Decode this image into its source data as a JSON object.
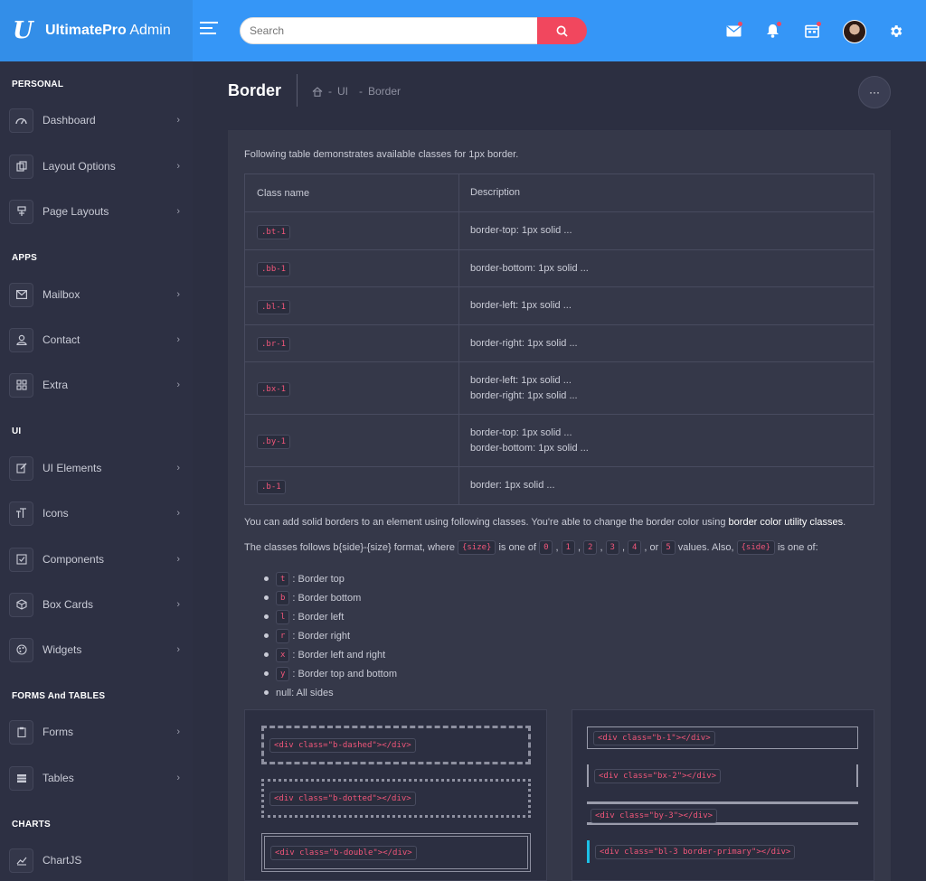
{
  "brand": {
    "logo": "U",
    "name_bold": "UltimatePro",
    "name_rest": " Admin"
  },
  "search": {
    "placeholder": "Search"
  },
  "colors": {
    "header": "#3596f7",
    "accent": "#f1475e",
    "code": "#f1567a",
    "primary": "#1cc0e6"
  },
  "sidebar": {
    "sections": [
      {
        "title": "PERSONAL",
        "items": [
          {
            "label": "Dashboard",
            "icon": "gauge-icon"
          },
          {
            "label": "Layout Options",
            "icon": "copy-icon"
          },
          {
            "label": "Page Layouts",
            "icon": "layers-icon"
          }
        ]
      },
      {
        "title": "APPS",
        "items": [
          {
            "label": "Mailbox",
            "icon": "mail-icon"
          },
          {
            "label": "Contact",
            "icon": "user-icon"
          },
          {
            "label": "Extra",
            "icon": "grid-icon"
          }
        ]
      },
      {
        "title": "UI",
        "items": [
          {
            "label": "UI Elements",
            "icon": "edit-icon"
          },
          {
            "label": "Icons",
            "icon": "text-size-icon"
          },
          {
            "label": "Components",
            "icon": "check-square-icon"
          },
          {
            "label": "Box Cards",
            "icon": "box-icon"
          },
          {
            "label": "Widgets",
            "icon": "palette-icon"
          }
        ]
      },
      {
        "title": "FORMS And TABLES",
        "items": [
          {
            "label": "Forms",
            "icon": "clipboard-icon"
          },
          {
            "label": "Tables",
            "icon": "table-icon"
          }
        ]
      },
      {
        "title": "CHARTS",
        "items": [
          {
            "label": "ChartJS",
            "icon": "chart-icon"
          }
        ]
      }
    ]
  },
  "page": {
    "title": "Border",
    "breadcrumb": [
      "UI",
      "Border"
    ],
    "more_label": "···"
  },
  "content": {
    "intro": "Following table demonstrates available classes for 1px border.",
    "table": {
      "headers": [
        "Class name",
        "Description"
      ],
      "rows": [
        {
          "cls": ".bt-1",
          "desc": [
            "border-top: 1px solid ..."
          ]
        },
        {
          "cls": ".bb-1",
          "desc": [
            "border-bottom: 1px solid ..."
          ]
        },
        {
          "cls": ".bl-1",
          "desc": [
            "border-left: 1px solid ..."
          ]
        },
        {
          "cls": ".br-1",
          "desc": [
            "border-right: 1px solid ..."
          ]
        },
        {
          "cls": ".bx-1",
          "desc": [
            "border-left: 1px solid ...",
            "border-right: 1px solid ..."
          ]
        },
        {
          "cls": ".by-1",
          "desc": [
            "border-top: 1px solid ...",
            "border-bottom: 1px solid ..."
          ]
        },
        {
          "cls": ".b-1",
          "desc": [
            "border: 1px solid ..."
          ]
        }
      ]
    },
    "p1_text": "You can add solid borders to an element using following classes. You're able to change the border color using ",
    "p1_bold": "border color utility classes",
    "p1_end": ".",
    "p2": {
      "t1": "The classes follows b{side}-{size} format, where",
      "size": "{size}",
      "t2": "is one of",
      "nums": [
        "0",
        "1",
        "2",
        "3",
        "4"
      ],
      "or": ", or",
      "last": "5",
      "t3": "values. Also,",
      "side": "{side}",
      "t4": "is one of:"
    },
    "sides": [
      {
        "code": "t",
        "text": ": Border top"
      },
      {
        "code": "b",
        "text": ": Border bottom"
      },
      {
        "code": "l",
        "text": ": Border left"
      },
      {
        "code": "r",
        "text": ": Border right"
      },
      {
        "code": "x",
        "text": ": Border left and right"
      },
      {
        "code": "y",
        "text": ": Border top and bottom"
      },
      {
        "code": "",
        "text": "null: All sides"
      }
    ],
    "demo_left": [
      "<div class=\"b-dashed\"></div>",
      "<div class=\"b-dotted\"></div>",
      "<div class=\"b-double\"></div>"
    ],
    "demo_right": [
      "<div class=\"b-1\"></div>",
      "<div class=\"bx-2\"></div>",
      "<div class=\"by-3\"></div>",
      "<div class=\"bl-3 border-primary\"></div>"
    ]
  }
}
